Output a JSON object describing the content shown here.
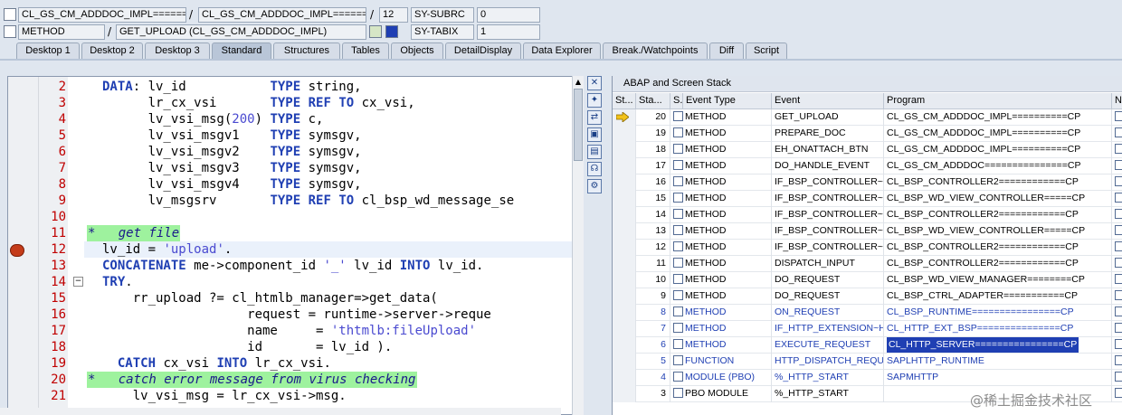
{
  "header": {
    "program1": "CL_GS_CM_ADDDOC_IMPL==========",
    "program2": "CL_GS_CM_ADDDOC_IMPL==========",
    "line_no": "12",
    "sy_subrc_label": "SY-SUBRC",
    "sy_subrc_value": "0",
    "type_value": "METHOD",
    "method_value": "GET_UPLOAD (CL_GS_CM_ADDDOC_IMPL)",
    "sy_tabix_label": "SY-TABIX",
    "sy_tabix_value": "1",
    "slash": "/"
  },
  "tabs": [
    "Desktop 1",
    "Desktop 2",
    "Desktop 3",
    "Standard",
    "Structures",
    "Tables",
    "Objects",
    "DetailDisplay",
    "Data Explorer",
    "Break./Watchpoints",
    "Diff",
    "Script"
  ],
  "active_tab": "Standard",
  "editor": {
    "lines": [
      {
        "n": "2",
        "t": "DATA: lv_id           TYPE string,"
      },
      {
        "n": "3",
        "t": "      lr_cx_vsi       TYPE REF TO cx_vsi,"
      },
      {
        "n": "4",
        "t": "      lv_vsi_msg(200) TYPE c,"
      },
      {
        "n": "5",
        "t": "      lv_vsi_msgv1    TYPE symsgv,"
      },
      {
        "n": "6",
        "t": "      lv_vsi_msgv2    TYPE symsgv,"
      },
      {
        "n": "7",
        "t": "      lv_vsi_msgv3    TYPE symsgv,"
      },
      {
        "n": "8",
        "t": "      lv_vsi_msgv4    TYPE symsgv,"
      },
      {
        "n": "9",
        "t": "      lv_msgsrv       TYPE REF TO cl_bsp_wd_message_se"
      },
      {
        "n": "10",
        "t": ""
      },
      {
        "n": "11",
        "t": "*   get file"
      },
      {
        "n": "12",
        "t": "lv_id = 'upload'."
      },
      {
        "n": "13",
        "t": "CONCATENATE me->component_id '_' lv_id INTO lv_id."
      },
      {
        "n": "14",
        "t": "TRY."
      },
      {
        "n": "15",
        "t": "    rr_upload ?= cl_htmlb_manager=>get_data("
      },
      {
        "n": "16",
        "t": "                   request = runtime->server->reque"
      },
      {
        "n": "17",
        "t": "                   name     = 'thtmlb:fileUpload'"
      },
      {
        "n": "18",
        "t": "                   id       = lv_id )."
      },
      {
        "n": "19",
        "t": "  CATCH cx_vsi INTO lr_cx_vsi."
      },
      {
        "n": "20",
        "t": "*   catch error message from virus checking"
      },
      {
        "n": "21",
        "t": "    lv_vsi_msg = lr_cx_vsi->msg."
      }
    ]
  },
  "stack": {
    "title": "ABAP and Screen Stack",
    "columns": [
      "St...",
      "Sta...",
      "S...",
      "Event Type",
      "Event",
      "Program",
      "Na"
    ],
    "rows": [
      {
        "level": "20",
        "type": "METHOD",
        "event": "GET_UPLOAD",
        "program": "CL_GS_CM_ADDDOC_IMPL==========CP",
        "current": true
      },
      {
        "level": "19",
        "type": "METHOD",
        "event": "PREPARE_DOC",
        "program": "CL_GS_CM_ADDDOC_IMPL==========CP"
      },
      {
        "level": "18",
        "type": "METHOD",
        "event": "EH_ONATTACH_BTN",
        "program": "CL_GS_CM_ADDDOC_IMPL==========CP"
      },
      {
        "level": "17",
        "type": "METHOD",
        "event": "DO_HANDLE_EVENT",
        "program": "CL_GS_CM_ADDDOC===============CP"
      },
      {
        "level": "16",
        "type": "METHOD",
        "event": "IF_BSP_CONTROLLER~H...",
        "program": "CL_BSP_CONTROLLER2============CP"
      },
      {
        "level": "15",
        "type": "METHOD",
        "event": "IF_BSP_CONTROLLER~H...",
        "program": "CL_BSP_WD_VIEW_CONTROLLER=====CP"
      },
      {
        "level": "14",
        "type": "METHOD",
        "event": "IF_BSP_CONTROLLER~H...",
        "program": "CL_BSP_CONTROLLER2============CP"
      },
      {
        "level": "13",
        "type": "METHOD",
        "event": "IF_BSP_CONTROLLER~H...",
        "program": "CL_BSP_WD_VIEW_CONTROLLER=====CP"
      },
      {
        "level": "12",
        "type": "METHOD",
        "event": "IF_BSP_CONTROLLER~H...",
        "program": "CL_BSP_CONTROLLER2============CP"
      },
      {
        "level": "11",
        "type": "METHOD",
        "event": "DISPATCH_INPUT",
        "program": "CL_BSP_CONTROLLER2============CP"
      },
      {
        "level": "10",
        "type": "METHOD",
        "event": "DO_REQUEST",
        "program": "CL_BSP_WD_VIEW_MANAGER========CP"
      },
      {
        "level": "9",
        "type": "METHOD",
        "event": "DO_REQUEST",
        "program": "CL_BSP_CTRL_ADAPTER===========CP"
      },
      {
        "level": "8",
        "type": "METHOD",
        "event": "ON_REQUEST",
        "program": "CL_BSP_RUNTIME================CP",
        "blue": true
      },
      {
        "level": "7",
        "type": "METHOD",
        "event": "IF_HTTP_EXTENSION~H...",
        "program": "CL_HTTP_EXT_BSP===============CP",
        "blue": true
      },
      {
        "level": "6",
        "type": "METHOD",
        "event": "EXECUTE_REQUEST",
        "program": "CL_HTTP_SERVER================CP",
        "blue": true,
        "selected": true
      },
      {
        "level": "5",
        "type": "FUNCTION",
        "event": "HTTP_DISPATCH_REQU...",
        "program": "SAPLHTTP_RUNTIME",
        "blue": true
      },
      {
        "level": "4",
        "type": "MODULE (PBO)",
        "event": "%_HTTP_START",
        "program": "SAPMHTTP",
        "blue": true
      },
      {
        "level": "3",
        "type": "PBO MODULE",
        "event": "%_HTTP_START",
        "program": ""
      }
    ]
  },
  "watermark": "@稀土掘金技术社区",
  "colors": {
    "keyword": "#1f3fb3",
    "comment_bg": "#9ef29e",
    "line_number": "#c00000",
    "selection": "#1f3fb3"
  }
}
